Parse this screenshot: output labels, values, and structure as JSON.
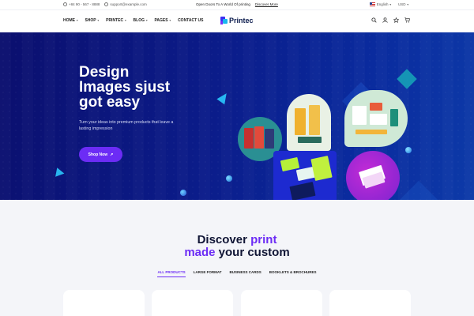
{
  "topbar": {
    "phone": "+84 90 - 567 - 8888",
    "email": "support@example.com",
    "promo_text": "Open Doors To A World Of printing",
    "promo_link": "Discover More",
    "language": "English",
    "currency": "USD"
  },
  "header": {
    "nav": [
      {
        "label": "HOME",
        "has_dropdown": true
      },
      {
        "label": "SHOP",
        "has_dropdown": true
      },
      {
        "label": "PRINTEC",
        "has_dropdown": true
      },
      {
        "label": "BLOG",
        "has_dropdown": true
      },
      {
        "label": "PAGES",
        "has_dropdown": true
      },
      {
        "label": "CONTACT US",
        "has_dropdown": false
      }
    ],
    "logo_text": "Printec",
    "icons": [
      "search-icon",
      "user-icon",
      "star-icon",
      "cart-icon"
    ]
  },
  "hero": {
    "title_lines": [
      "Design",
      "Images sjust",
      "got easy"
    ],
    "subtitle": "Turn your ideas into premium products that leave a lasting impression",
    "button_label": "Shop Now",
    "button_icon": "arrow-up-right-icon"
  },
  "section": {
    "title_part1": "Discover ",
    "title_accent1": "print",
    "title_accent2": "made",
    "title_part2": " your custom",
    "tabs": [
      {
        "label": "ALL PRODUCTS",
        "active": true
      },
      {
        "label": "LARGE FORMAT",
        "active": false
      },
      {
        "label": "BUSINESS CARDS",
        "active": false
      },
      {
        "label": "BOOKLETS & BROCHURES",
        "active": false
      }
    ]
  },
  "colors": {
    "accent": "#6c2cf5",
    "hero_bg": "#0b1c8a",
    "logo_blue": "#3b2ff2",
    "logo_cyan": "#19b8f0"
  }
}
